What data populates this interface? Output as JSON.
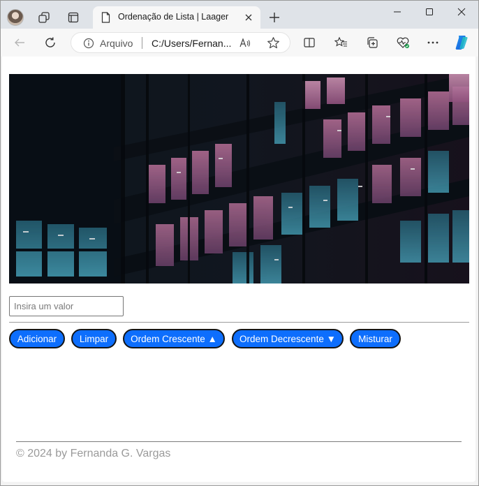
{
  "browser": {
    "tab": {
      "title": "Ordenação de Lista | Laager"
    },
    "address": {
      "scheme_label": "Arquivo",
      "url": "C:/Users/Fernan..."
    },
    "icons": {
      "profile": "profile-avatar",
      "workspaces": "workspaces-icon",
      "tab_actions": "tab-actions-icon",
      "tab_page": "document-icon",
      "tab_close": "close-icon",
      "new_tab": "plus-icon",
      "minimize": "minimize-icon",
      "maximize": "maximize-icon",
      "close_window": "close-icon",
      "back": "back-arrow-icon",
      "refresh": "refresh-icon",
      "info": "info-icon",
      "read_aloud": "read-aloud-icon",
      "favorite": "star-icon",
      "split_screen": "split-screen-icon",
      "favorites": "favorites-icon",
      "collections": "collections-icon",
      "browser_essentials": "heart-pulse-icon",
      "more": "more-icon",
      "copilot": "copilot-icon"
    }
  },
  "page": {
    "hero_image": "office-building-night-photo",
    "input": {
      "placeholder": "Insira um valor",
      "value": ""
    },
    "buttons": {
      "add": "Adicionar",
      "clear": "Limpar",
      "sort_asc": "Ordem Crescente ▲",
      "sort_desc": "Ordem Decrescente ▼",
      "shuffle": "Misturar"
    },
    "footer": "© 2024 by Fernanda G. Vargas"
  },
  "colors": {
    "button_bg": "#0d6efd",
    "button_border": "#151515",
    "footer_text": "#9a9a9a",
    "tabstrip_bg": "#dfe3e8"
  }
}
